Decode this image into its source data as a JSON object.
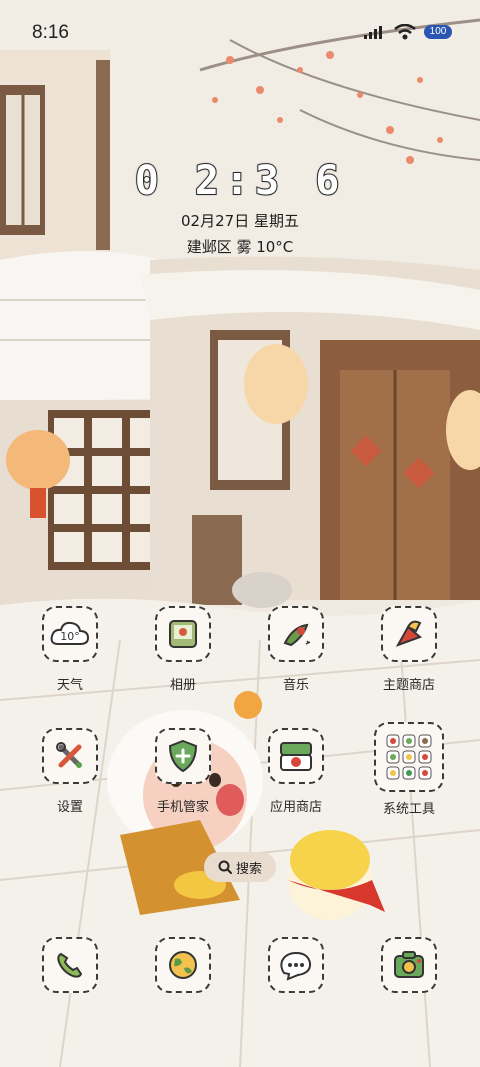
{
  "status_bar": {
    "time": "8:16",
    "battery": "100"
  },
  "clock": {
    "digits": "0 2:3 6",
    "date": "02月27日 星期五",
    "weather": "建邺区 雾 10°C"
  },
  "apps": [
    {
      "label": "天气",
      "icon": "weather-icon",
      "icon_text": "10°"
    },
    {
      "label": "相册",
      "icon": "gallery-icon"
    },
    {
      "label": "音乐",
      "icon": "music-icon"
    },
    {
      "label": "主题商店",
      "icon": "theme-store-icon"
    },
    {
      "label": "设置",
      "icon": "settings-icon"
    },
    {
      "label": "手机管家",
      "icon": "phone-manager-icon"
    },
    {
      "label": "应用商店",
      "icon": "app-store-icon"
    },
    {
      "label": "系统工具",
      "icon": "system-tools-folder-icon"
    }
  ],
  "search": {
    "label": "搜索"
  },
  "dock": [
    {
      "icon": "phone-icon"
    },
    {
      "icon": "browser-icon"
    },
    {
      "icon": "messages-icon"
    },
    {
      "icon": "camera-icon"
    }
  ]
}
